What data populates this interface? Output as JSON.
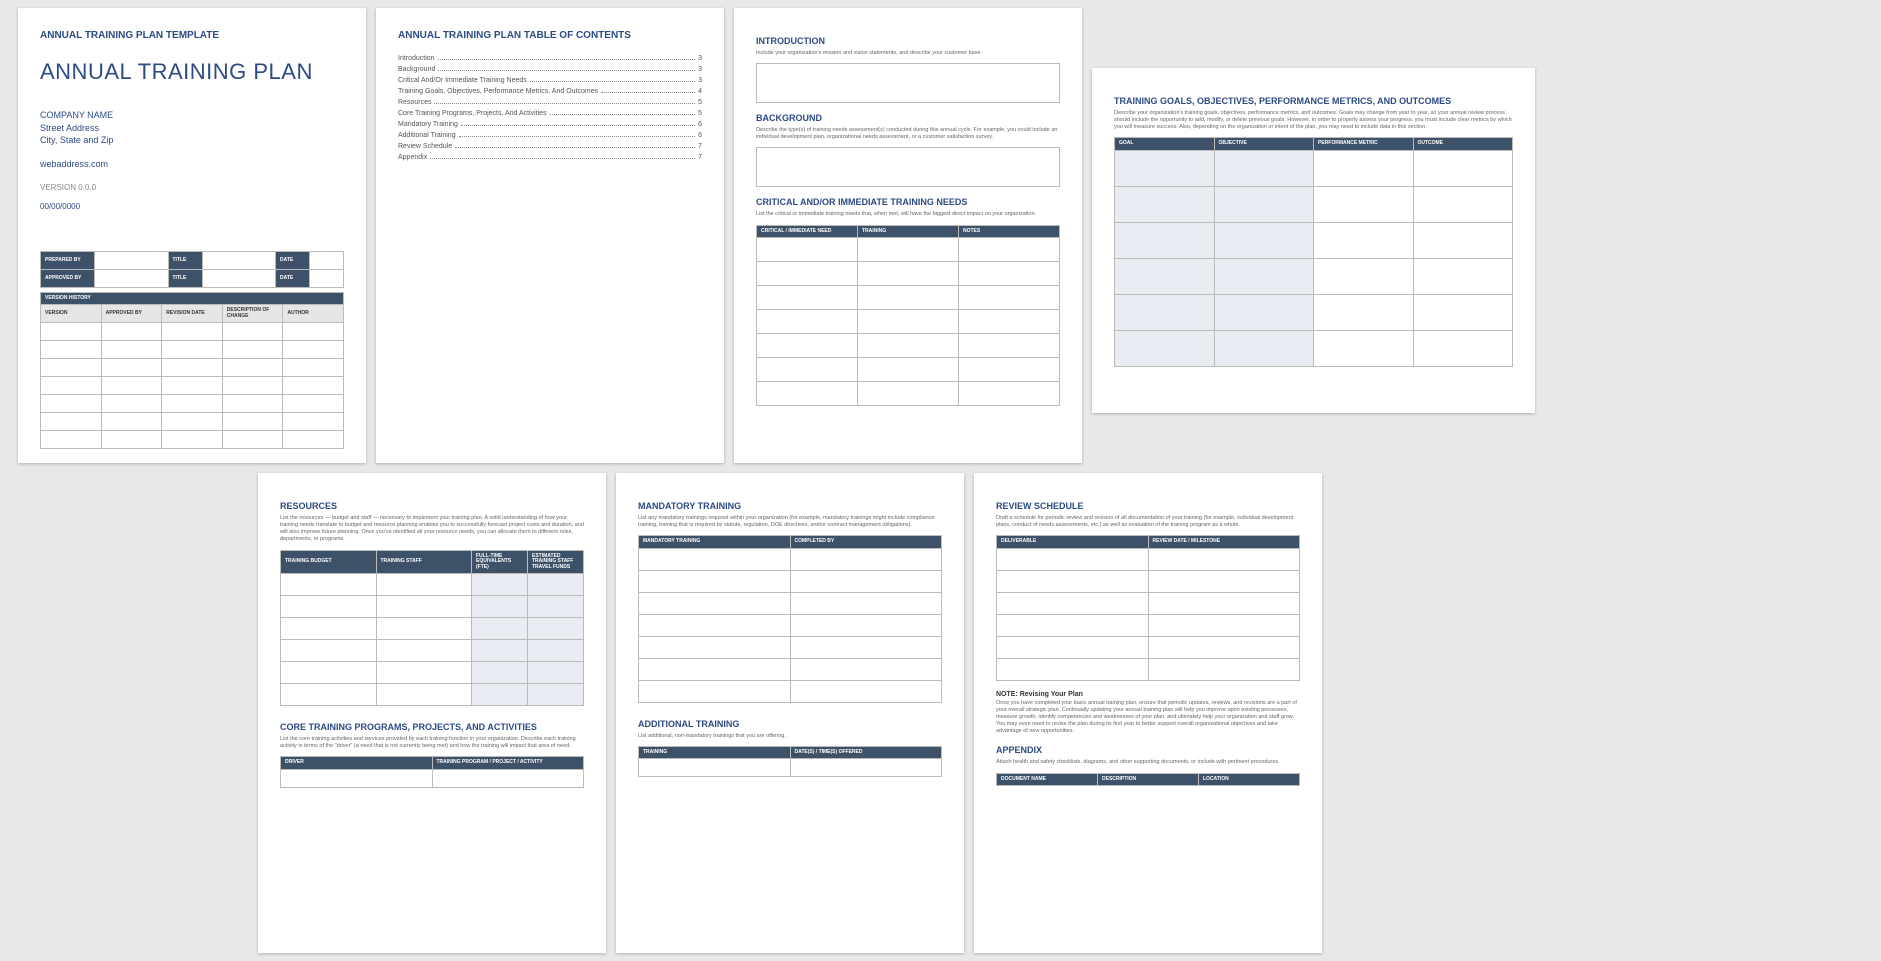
{
  "page1": {
    "template_header": "ANNUAL TRAINING PLAN TEMPLATE",
    "title": "ANNUAL TRAINING PLAN",
    "company": "COMPANY NAME",
    "street": "Street Address",
    "city": "City, State and Zip",
    "web": "webaddress.com",
    "version": "VERSION 0.0.0",
    "date": "00/00/0000",
    "meta_rows": {
      "prepared_by": "PREPARED BY",
      "approved_by": "APPROVED BY",
      "title": "TITLE",
      "date": "DATE"
    },
    "history_header": "VERSION HISTORY",
    "history_cols": [
      "VERSION",
      "APPROVED BY",
      "REVISION DATE",
      "DESCRIPTION OF CHANGE",
      "AUTHOR"
    ]
  },
  "page2": {
    "heading": "ANNUAL TRAINING PLAN TABLE OF CONTENTS",
    "items": [
      {
        "label": "Introduction",
        "pg": "3"
      },
      {
        "label": "Background",
        "pg": "3"
      },
      {
        "label": "Critical And/Or Immediate Training Needs",
        "pg": "3"
      },
      {
        "label": "Training Goals, Objectives, Performance Metrics, And Outcomes",
        "pg": "4"
      },
      {
        "label": "Resources",
        "pg": "5"
      },
      {
        "label": "Core Training Programs, Projects, And Activities",
        "pg": "5"
      },
      {
        "label": "Mandatory Training",
        "pg": "6"
      },
      {
        "label": "Additional Training",
        "pg": "6"
      },
      {
        "label": "Review Schedule",
        "pg": "7"
      },
      {
        "label": "Appendix",
        "pg": "7"
      }
    ]
  },
  "page3": {
    "intro_head": "INTRODUCTION",
    "intro_desc": "Include your organization's mission and vision statements, and describe your customer base.",
    "bg_head": "BACKGROUND",
    "bg_desc": "Describe the type(s) of training needs assessment(s) conducted during this annual cycle. For example, you could include an individual development plan, organizational needs assessment, or a customer satisfaction survey.",
    "crit_head": "CRITICAL AND/OR IMMEDIATE TRAINING NEEDS",
    "crit_desc": "List the critical or immediate training needs that, when met, will have the biggest direct impact on your organization.",
    "crit_cols": [
      "CRITICAL / IMMEDIATE NEED",
      "TRAINING",
      "NOTES"
    ]
  },
  "page4": {
    "head": "TRAINING GOALS, OBJECTIVES, PERFORMANCE METRICS, AND OUTCOMES",
    "desc": "Describe your organization's training goals, objectives, performance metrics, and outcomes. Goals may change from year to year, so your annual review process should include the opportunity to add, modify, or delete previous goals. However, in order to properly assess your progress, you must include clear metrics by which you will measure success. Also, depending on the organization or intent of the plan, you may need to include data in this section.",
    "cols": [
      "GOAL",
      "OBJECTIVE",
      "PERFORMANCE METRIC",
      "OUTCOME"
    ]
  },
  "page5": {
    "res_head": "RESOURCES",
    "res_desc": "List the resources — budget and staff — necessary to implement your training plan. A solid understanding of how your training needs translate to budget and resource planning enables you to successfully forecast project costs and duration, and will also improve future planning. Once you've identified all your resource needs, you can allocate them to different roles, departments, or programs.",
    "res_cols": [
      "TRAINING BUDGET",
      "TRAINING STAFF",
      "FULL-TIME EQUIVALENTS (FTE)",
      "ESTIMATED TRAINING STAFF TRAVEL FUNDS"
    ],
    "core_head": "CORE TRAINING PROGRAMS, PROJECTS, AND ACTIVITIES",
    "core_desc": "List the core training activities and services provided by each training function in your organization. Describe each training activity in terms of the \"driver\" (a need that is not currently being met) and how the training will impact that area of need.",
    "core_cols": [
      "DRIVER",
      "TRAINING PROGRAM / PROJECT / ACTIVITY"
    ]
  },
  "page6": {
    "mand_head": "MANDATORY TRAINING",
    "mand_desc": "List any mandatory trainings required within your organization (for example, mandatory trainings might include compliance training, training that is required by statute, regulation, DOE directives, and/or contract management obligations).",
    "mand_cols": [
      "MANDATORY TRAINING",
      "COMPLETED BY"
    ],
    "add_head": "ADDITIONAL TRAINING",
    "add_desc": "List additional, non-mandatory trainings that you are offering.",
    "add_cols": [
      "TRAINING",
      "DATE(S) / TIME(S) OFFERED"
    ]
  },
  "page7": {
    "rev_head": "REVIEW SCHEDULE",
    "rev_desc": "Draft a schedule for periodic review and revision of all documentation of your training (for example, individual development plans, conduct of needs assessments, etc.) as well as evaluation of the training program as a whole.",
    "rev_cols": [
      "DELIVERABLE",
      "REVIEW DATE / MILESTONE"
    ],
    "note_head": "NOTE: Revising Your Plan",
    "note_body": "Once you have completed your basic annual training plan, ensure that periodic updates, reviews, and revisions are a part of your overall strategic plan. Continually updating your annual training plan will help you improve upon existing processes, measure growth, identify competencies and weaknesses of your plan, and ultimately help your organization and staff grow. You may even need to revise the plan during its first year to better support overall organizational objectives and take advantage of new opportunities.",
    "app_head": "APPENDIX",
    "app_desc": "Attach health and safety checklists, diagrams, and other supporting documents, or include with pertinent procedures.",
    "app_cols": [
      "DOCUMENT NAME",
      "DESCRIPTION",
      "LOCATION"
    ]
  }
}
